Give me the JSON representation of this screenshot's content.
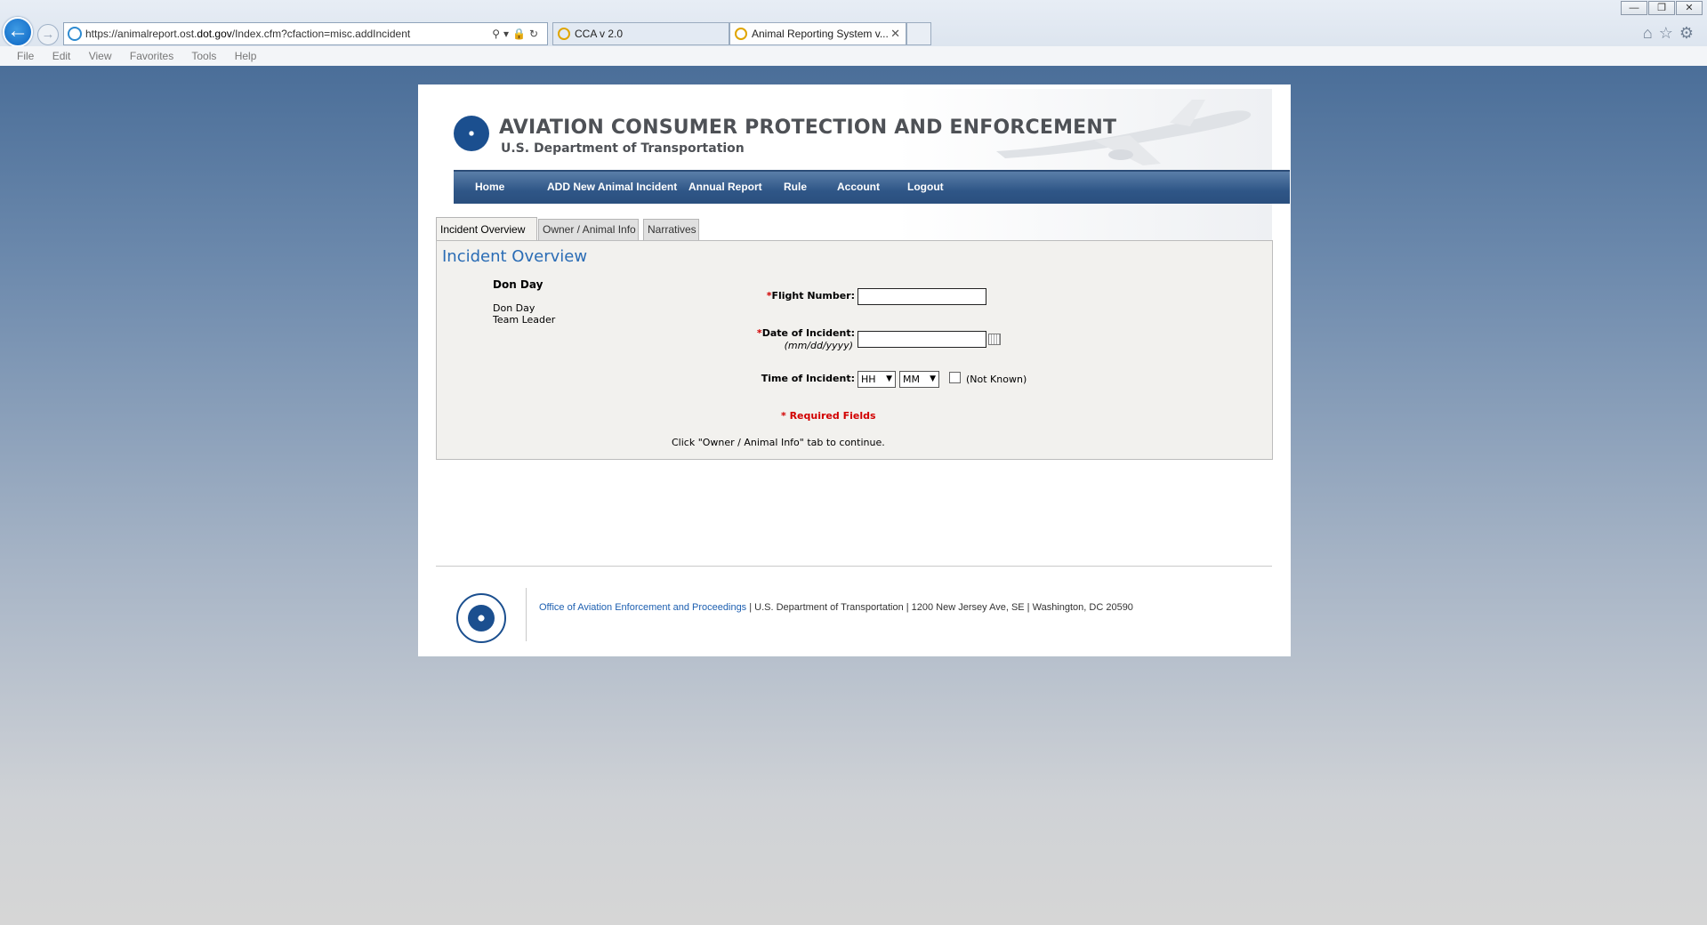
{
  "browser": {
    "url_prefix": "https://animalreport.ost.",
    "url_domain": "dot.gov",
    "url_path": "/Index.cfm?cfaction=misc.addIncident",
    "tabs": [
      {
        "label": "CCA v 2.0"
      },
      {
        "label": "Animal Reporting System v..."
      }
    ],
    "menu": [
      "File",
      "Edit",
      "View",
      "Favorites",
      "Tools",
      "Help"
    ]
  },
  "header": {
    "title": "AVIATION CONSUMER PROTECTION AND ENFORCEMENT",
    "subtitle": "U.S. Department of Transportation"
  },
  "nav": [
    "Home",
    "ADD New Animal Incident",
    "Annual Report",
    "Rule",
    "Account",
    "Logout"
  ],
  "tabs": [
    "Incident Overview",
    "Owner / Animal Info",
    "Narratives"
  ],
  "panel": {
    "title": "Incident Overview",
    "user_name_bold": "Don Day",
    "user_name": "Don Day",
    "user_role": "Team Leader",
    "flight_label": "Flight Number:",
    "flight_value": "",
    "date_label": "Date of Incident:",
    "date_hint": "(mm/dd/yyyy)",
    "date_value": "",
    "time_label": "Time of Incident:",
    "hour_value": "HH",
    "minute_value": "MM",
    "not_known_label": "(Not Known)",
    "required_star": "*",
    "required_text": "* Required Fields",
    "continue_text": "Click \"Owner / Animal Info\" tab to continue."
  },
  "footer": {
    "office_link": "Office of Aviation Enforcement and Proceedings",
    "address": " | U.S. Department of Transportation | 1200 New Jersey Ave, SE | Washington, DC 20590"
  }
}
